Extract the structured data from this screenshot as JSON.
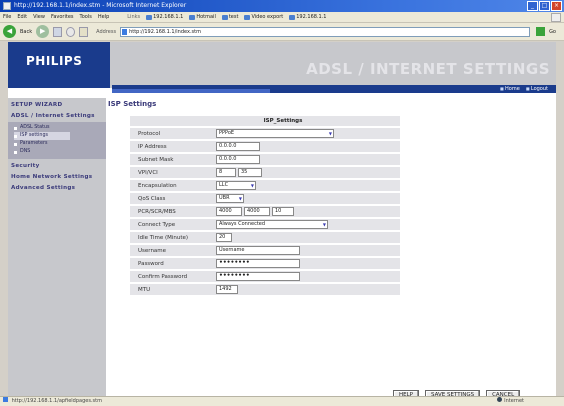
{
  "window": {
    "title": "http://192.168.1.1/index.stm - Microsoft Internet Explorer"
  },
  "menubar": {
    "items": [
      "File",
      "Edit",
      "View",
      "Favorites",
      "Tools",
      "Help"
    ],
    "links_label": "Links",
    "links": [
      "192.168.1.1",
      "Hotmail",
      "test",
      "Video export",
      "192.168.1.1"
    ]
  },
  "toolbar": {
    "back_label": "Back",
    "address_label": "Address",
    "address_value": "http://192.168.1.1/index.stm",
    "go_label": "Go"
  },
  "header": {
    "logo": "PHILIPS",
    "title": "ADSL / INTERNET SETTINGS",
    "links": [
      "Home",
      "Logout"
    ]
  },
  "sidebar": {
    "setup_wizard": "SETUP WIZARD",
    "adsl_settings": "ADSL / Internet Settings",
    "sub_items": [
      "ADSL Status",
      "ISP settings",
      "Parameters",
      "DNS"
    ],
    "security": "Security",
    "home_network": "Home Network Settings",
    "advanced": "Advanced Settings"
  },
  "main": {
    "section_title": "ISP Settings",
    "table_title": "ISP_Settings",
    "fields": {
      "protocol": {
        "label": "Protocol",
        "value": "PPPoE"
      },
      "ip_address": {
        "label": "IP Address",
        "value": "0.0.0.0"
      },
      "subnet_mask": {
        "label": "Subnet Mask",
        "value": "0.0.0.0"
      },
      "vpi_vci": {
        "label": "VPI/VCI",
        "vpi": "8",
        "vci": "35"
      },
      "encapsulation": {
        "label": "Encapsulation",
        "value": "LLC"
      },
      "qos_class": {
        "label": "QoS Class",
        "value": "UBR"
      },
      "pcr_scr_mbs": {
        "label": "PCR/SCR/MBS",
        "pcr": "4000",
        "scr": "4000",
        "mbs": "10"
      },
      "connect_type": {
        "label": "Connect Type",
        "value": "Always Connected"
      },
      "idle_time": {
        "label": "Idle Time (Minute)",
        "value": "20"
      },
      "username": {
        "label": "Username",
        "value": "Username"
      },
      "password": {
        "label": "Password",
        "value": "••••••••"
      },
      "confirm_password": {
        "label": "Confirm Password",
        "value": "••••••••"
      },
      "mtu": {
        "label": "MTU",
        "value": "1492"
      }
    }
  },
  "buttons": {
    "help": "HELP",
    "save": "SAVE SETTINGS",
    "cancel": "CANCEL"
  },
  "statusbar": {
    "url": "http://192.168.1.1/apfieldpages.stm",
    "zone": "Internet"
  }
}
